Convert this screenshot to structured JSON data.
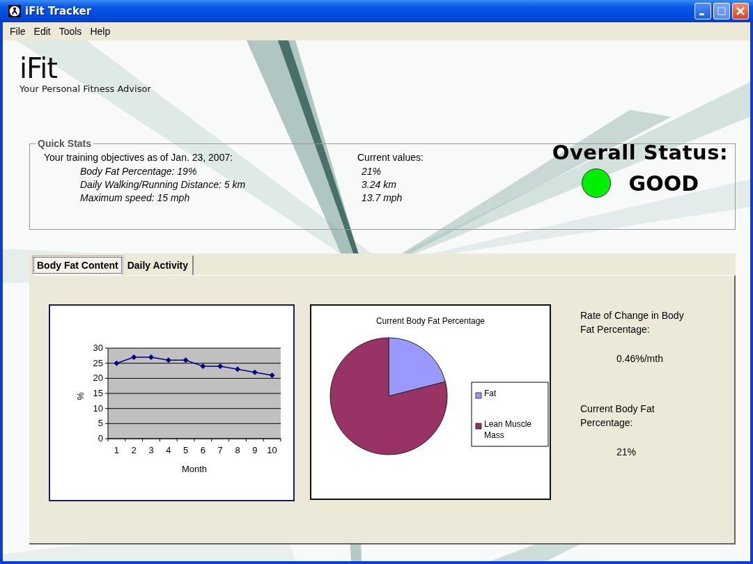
{
  "window": {
    "title": "iFit Tracker"
  },
  "menu": [
    "File",
    "Edit",
    "Tools",
    "Help"
  ],
  "logo": {
    "name": "iFit",
    "tagline": "Your Personal Fitness Advisor"
  },
  "quick_stats": {
    "title": "Quick Stats",
    "objectives_heading": "Your training objectives as of Jan. 23, 2007:",
    "objectives": [
      "Body Fat Percentage: 19%",
      "Daily Walking/Running Distance: 5 km",
      "Maximum speed: 15 mph"
    ],
    "current_heading": "Current values:",
    "current": [
      "21%",
      "3.24 km",
      "13.7 mph"
    ]
  },
  "overall_status": {
    "label": "Overall Status:",
    "value": "GOOD",
    "color": "#00ee00"
  },
  "tabs": [
    {
      "label": "Body Fat Content",
      "selected": true
    },
    {
      "label": "Daily Activity",
      "selected": false
    }
  ],
  "line_chart": {
    "chart_data": {
      "type": "line",
      "grid": true,
      "xlabel": "Month",
      "ylabel": "%",
      "categories": [
        "1",
        "2",
        "3",
        "4",
        "5",
        "6",
        "7",
        "8",
        "9",
        "10"
      ],
      "ylim": [
        0,
        30
      ],
      "yticks": [
        0,
        5,
        10,
        15,
        20,
        25,
        30
      ],
      "series": [
        {
          "color": "#000080",
          "marker": "diamond",
          "values": [
            25,
            27,
            27,
            26,
            26,
            24,
            24,
            23,
            22,
            21
          ]
        }
      ]
    }
  },
  "pie_chart": {
    "chart_data": {
      "type": "pie",
      "title": "Current Body Fat Percentage",
      "categories": [
        "Fat",
        "Lean Muscle Mass"
      ],
      "values": [
        21,
        79
      ],
      "legend": "right",
      "colors": [
        "#9999ff",
        "#993366"
      ]
    }
  },
  "summary": [
    {
      "label": "Rate of Change in Body Fat Percentage:",
      "value": "0.46%/mth"
    },
    {
      "label": "Current Body Fat Percentage:",
      "value": "21%"
    }
  ]
}
